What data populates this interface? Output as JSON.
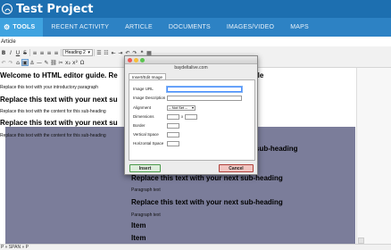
{
  "app": {
    "title": "Test Project"
  },
  "nav": {
    "tabs": [
      {
        "label": "TOOLS",
        "active": true
      },
      {
        "label": "RECENT ACTIVITY"
      },
      {
        "label": "ARTICLE"
      },
      {
        "label": "DOCUMENTS"
      },
      {
        "label": "IMAGES/VIDEO"
      },
      {
        "label": "MAPS"
      }
    ]
  },
  "page": {
    "section_label": "Article"
  },
  "toolbar": {
    "format_select": "Heading 2"
  },
  "editor": {
    "blocks": [
      {
        "kind": "h",
        "text": "Welcome to HTML editor guide. Re"
      },
      {
        "kind": "h_right",
        "text": "tle"
      },
      {
        "kind": "p",
        "text": "Replace this text with your introductory paragraph"
      },
      {
        "kind": "h",
        "text": "Replace this text with your next su"
      },
      {
        "kind": "p",
        "text": "Replace this text with the content for this sub-heading"
      },
      {
        "kind": "h",
        "text": "Replace this text with your next su"
      },
      {
        "kind": "p",
        "text": "Replace this text with the content for this sub-heading"
      },
      {
        "kind": "h",
        "text": "sub-heading"
      },
      {
        "kind": "h",
        "text": "Replace this text with your next sub-heading"
      },
      {
        "kind": "p",
        "text": "Paragraph text"
      },
      {
        "kind": "h",
        "text": "Replace this text with your next sub-heading"
      },
      {
        "kind": "p",
        "text": "Paragraph text"
      },
      {
        "kind": "h",
        "text": "Item"
      },
      {
        "kind": "h",
        "text": "Item"
      }
    ]
  },
  "statusbar": {
    "text": "P » SPAN » P"
  },
  "dialog": {
    "url": "baydeltalive.com",
    "tab": "Insert/Edit Image",
    "fields": {
      "image_url": "Image URL",
      "image_description": "Image Description",
      "alignment": "Alignment",
      "alignment_value": "-- Not Set --",
      "dimensions": "Dimensions",
      "dim_x": "x",
      "border": "Border",
      "vertical_space": "Vertical Space",
      "horizontal_space": "Horizontal Space"
    },
    "insert_label": "Insert",
    "cancel_label": "Cancel"
  },
  "colors": {
    "header": "#1d6fb0",
    "nav": "#2d82c4",
    "nav_active": "#3fa3e0",
    "placeholder_block": "#7b7d9a"
  }
}
